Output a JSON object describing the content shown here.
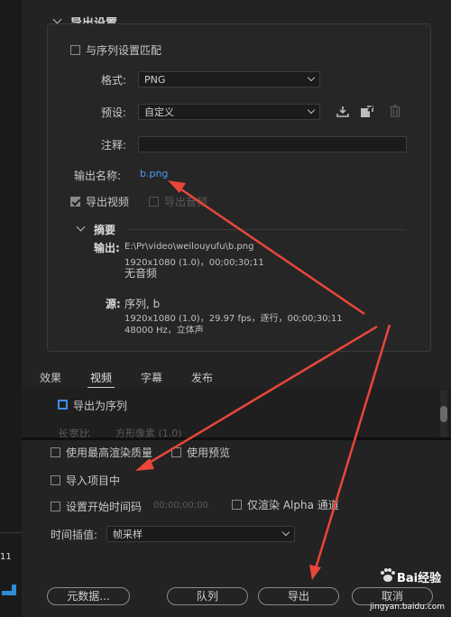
{
  "export_settings": {
    "title": "导出设置",
    "match_sequence_label": "与序列设置匹配",
    "format_label": "格式:",
    "format_value": "PNG",
    "preset_label": "预设:",
    "preset_value": "自定义",
    "comment_label": "注释:",
    "comment_value": "",
    "output_name_label": "输出名称:",
    "output_name_value": "b.png",
    "export_video_label": "导出视频",
    "export_audio_label": "导出音频"
  },
  "summary": {
    "title": "摘要",
    "output_label": "输出:",
    "output_path": "E:\\Pr\\video\\weilouyufu\\b.png",
    "output_specs": "1920x1080 (1.0)，00;00;30;11",
    "output_audio": "无音频",
    "source_label": "源:",
    "source_name": "序列, b",
    "source_specs": "1920x1080 (1.0)，29.97 fps，逐行，00;00;30;11",
    "source_audio": "48000 Hz，立体声"
  },
  "tabs": [
    "效果",
    "视频",
    "字幕",
    "发布"
  ],
  "active_tab": "视频",
  "video_tab": {
    "export_as_sequence_label": "导出为序列",
    "aspect_label": "长宽比",
    "aspect_value": "方形像素 (1.0)"
  },
  "bottom_options": {
    "max_quality_label": "使用最高渲染质量",
    "use_preview_label": "使用预览",
    "import_to_project_label": "导入项目中",
    "set_start_timecode_label": "设置开始时间码",
    "start_timecode_value": "00;00;00;00",
    "alpha_only_label": "仅渲染 Alpha 通道",
    "time_interp_label": "时间插值:",
    "time_interp_value": "帧采样"
  },
  "buttons": {
    "metadata": "元数据...",
    "queue": "队列",
    "export": "导出",
    "cancel": "取消"
  },
  "left_strip_text": "11",
  "watermark": {
    "brand": "Bai经验",
    "url": "jingyan.baidu.com"
  },
  "colors": {
    "accent_blue": "#3a8ee6",
    "link_blue": "#4a9cf0",
    "annotation_red": "#e8463a"
  }
}
